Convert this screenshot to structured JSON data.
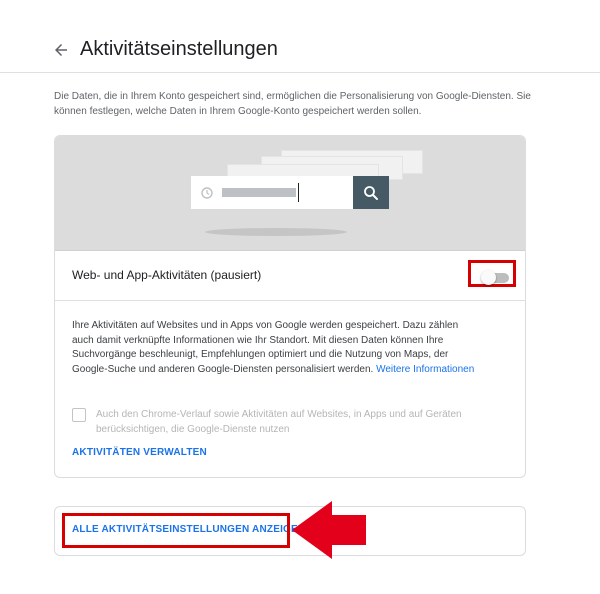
{
  "header": {
    "back_icon": "arrow-back-icon",
    "title": "Aktivitätseinstellungen"
  },
  "intro": "Die Daten, die in Ihrem Konto gespeichert sind, ermöglichen die Personalisierung von Google-Diensten. Sie können festlegen, welche Daten in Ihrem Google-Konto gespeichert werden sollen.",
  "activity_card": {
    "illustration": {
      "clock_icon": "clock-icon",
      "search_icon": "search-icon"
    },
    "toggle": {
      "label": "Web- und App-Aktivitäten (pausiert)",
      "state": "off"
    },
    "description": "Ihre Aktivitäten auf Websites und in Apps von Google werden gespeichert. Dazu zählen auch damit verknüpfte Informationen wie Ihr Standort. Mit diesen Daten können Ihre Suchvorgänge beschleunigt, Empfehlungen optimiert und die Nutzung von Maps, der Google-Suche und anderen Google-Diensten personalisiert werden.",
    "more_info_link": "Weitere Informationen",
    "checkbox_label": "Auch den Chrome-Verlauf sowie Aktivitäten auf Websites, in Apps und auf Geräten berücksichtigen, die Google-Dienste nutzen",
    "manage_link": "AKTIVITÄTEN VERWALTEN"
  },
  "all_settings_link": "ALLE AKTIVITÄTSEINSTELLUNGEN ANZEIGEN",
  "colors": {
    "link": "#1a73e8",
    "highlight": "#d50000",
    "search_button": "#455a64"
  }
}
